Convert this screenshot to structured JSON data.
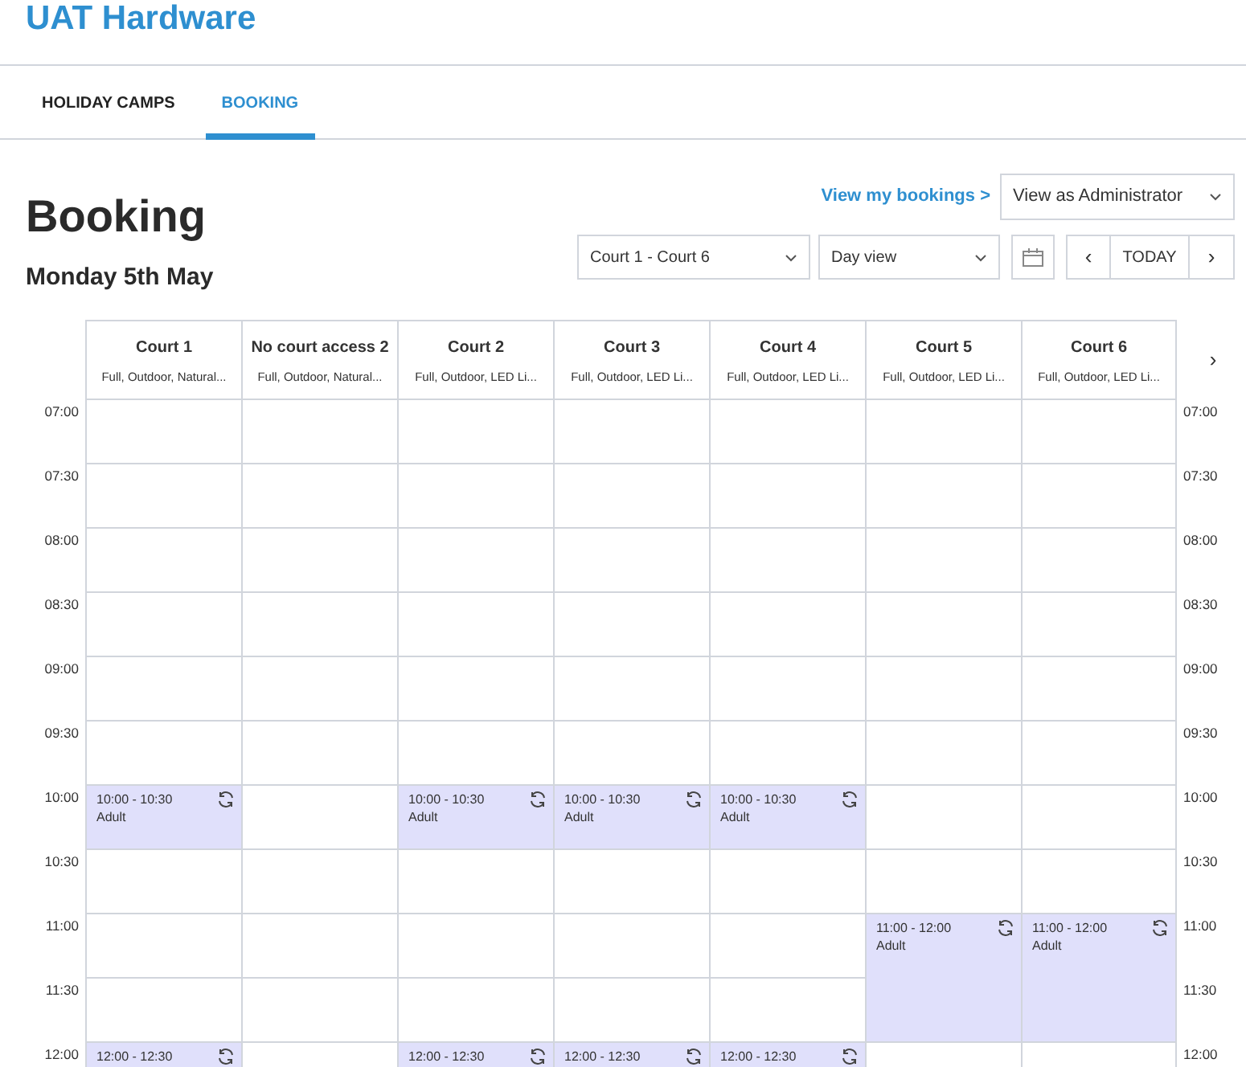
{
  "brand": "UAT Hardware",
  "tabs": [
    {
      "label": "HOLIDAY CAMPS",
      "selected": false
    },
    {
      "label": "BOOKING",
      "selected": true
    }
  ],
  "page_title": "Booking",
  "date": "Monday 5th May",
  "my_bookings_link": "View my bookings >",
  "view_as": "View as Administrator",
  "court_range": "Court 1 - Court 6",
  "view_mode": "Day view",
  "nav": {
    "prev": "‹",
    "today": "TODAY",
    "next": "›"
  },
  "more_columns": "›",
  "times_left": [
    "07:00",
    "07:30",
    "08:00",
    "08:30",
    "09:00",
    "09:30",
    "10:00",
    "10:30",
    "11:00",
    "11:30",
    "12:00"
  ],
  "times_right": [
    "07:00",
    "07:30",
    "08:00",
    "08:30",
    "09:00",
    "09:30",
    "10:00",
    "10:30",
    "11:00",
    "11:30",
    "12:00"
  ],
  "courts": [
    {
      "name": "Court 1",
      "details": "Full, Outdoor, Natural...",
      "cells": [
        {
          "kind": "free"
        },
        {
          "kind": "free"
        },
        {
          "kind": "free"
        },
        {
          "kind": "free"
        },
        {
          "kind": "free"
        },
        {
          "kind": "free"
        },
        {
          "kind": "booking",
          "time": "10:00 - 10:30",
          "label": "Adult"
        },
        {
          "kind": "free"
        },
        {
          "kind": "free"
        },
        {
          "kind": "free"
        },
        {
          "kind": "booking",
          "time": "12:00 - 12:30"
        }
      ]
    },
    {
      "name": "No court access 2",
      "details": "Full, Outdoor, Natural...",
      "cells": [
        {
          "kind": "free"
        },
        {
          "kind": "free"
        },
        {
          "kind": "free"
        },
        {
          "kind": "free"
        },
        {
          "kind": "free"
        },
        {
          "kind": "free"
        },
        {
          "kind": "free"
        },
        {
          "kind": "free"
        },
        {
          "kind": "free"
        },
        {
          "kind": "free"
        },
        {
          "kind": "free"
        }
      ]
    },
    {
      "name": "Court 2",
      "details": "Full, Outdoor, LED Li...",
      "cells": [
        {
          "kind": "free"
        },
        {
          "kind": "free"
        },
        {
          "kind": "free"
        },
        {
          "kind": "free"
        },
        {
          "kind": "free"
        },
        {
          "kind": "free"
        },
        {
          "kind": "booking",
          "time": "10:00 - 10:30",
          "label": "Adult"
        },
        {
          "kind": "free"
        },
        {
          "kind": "free"
        },
        {
          "kind": "free"
        },
        {
          "kind": "booking",
          "time": "12:00 - 12:30"
        }
      ]
    },
    {
      "name": "Court 3",
      "details": "Full, Outdoor, LED Li...",
      "cells": [
        {
          "kind": "free"
        },
        {
          "kind": "free"
        },
        {
          "kind": "free"
        },
        {
          "kind": "free"
        },
        {
          "kind": "free"
        },
        {
          "kind": "free"
        },
        {
          "kind": "booking",
          "time": "10:00 - 10:30",
          "label": "Adult"
        },
        {
          "kind": "free"
        },
        {
          "kind": "free"
        },
        {
          "kind": "free"
        },
        {
          "kind": "booking",
          "time": "12:00 - 12:30"
        }
      ]
    },
    {
      "name": "Court 4",
      "details": "Full, Outdoor, LED Li...",
      "cells": [
        {
          "kind": "free"
        },
        {
          "kind": "free"
        },
        {
          "kind": "free"
        },
        {
          "kind": "free"
        },
        {
          "kind": "free"
        },
        {
          "kind": "free"
        },
        {
          "kind": "booking",
          "time": "10:00 - 10:30",
          "label": "Adult"
        },
        {
          "kind": "free"
        },
        {
          "kind": "free"
        },
        {
          "kind": "free"
        },
        {
          "kind": "booking",
          "time": "12:00 - 12:30"
        }
      ]
    },
    {
      "name": "Court 5",
      "details": "Full, Outdoor, LED Li...",
      "cells": [
        {
          "kind": "free"
        },
        {
          "kind": "free"
        },
        {
          "kind": "free"
        },
        {
          "kind": "free"
        },
        {
          "kind": "free"
        },
        {
          "kind": "free"
        },
        {
          "kind": "free"
        },
        {
          "kind": "free"
        },
        {
          "kind": "booking_hour",
          "time": "11:00 - 12:00",
          "label": "Adult"
        },
        {
          "kind": "free"
        }
      ]
    },
    {
      "name": "Court 6",
      "details": "Full, Outdoor, LED Li...",
      "cells": [
        {
          "kind": "free"
        },
        {
          "kind": "free"
        },
        {
          "kind": "free"
        },
        {
          "kind": "free"
        },
        {
          "kind": "free"
        },
        {
          "kind": "free"
        },
        {
          "kind": "free"
        },
        {
          "kind": "free"
        },
        {
          "kind": "booking_hour",
          "time": "11:00 - 12:00",
          "label": "Adult"
        },
        {
          "kind": "free"
        }
      ]
    }
  ]
}
